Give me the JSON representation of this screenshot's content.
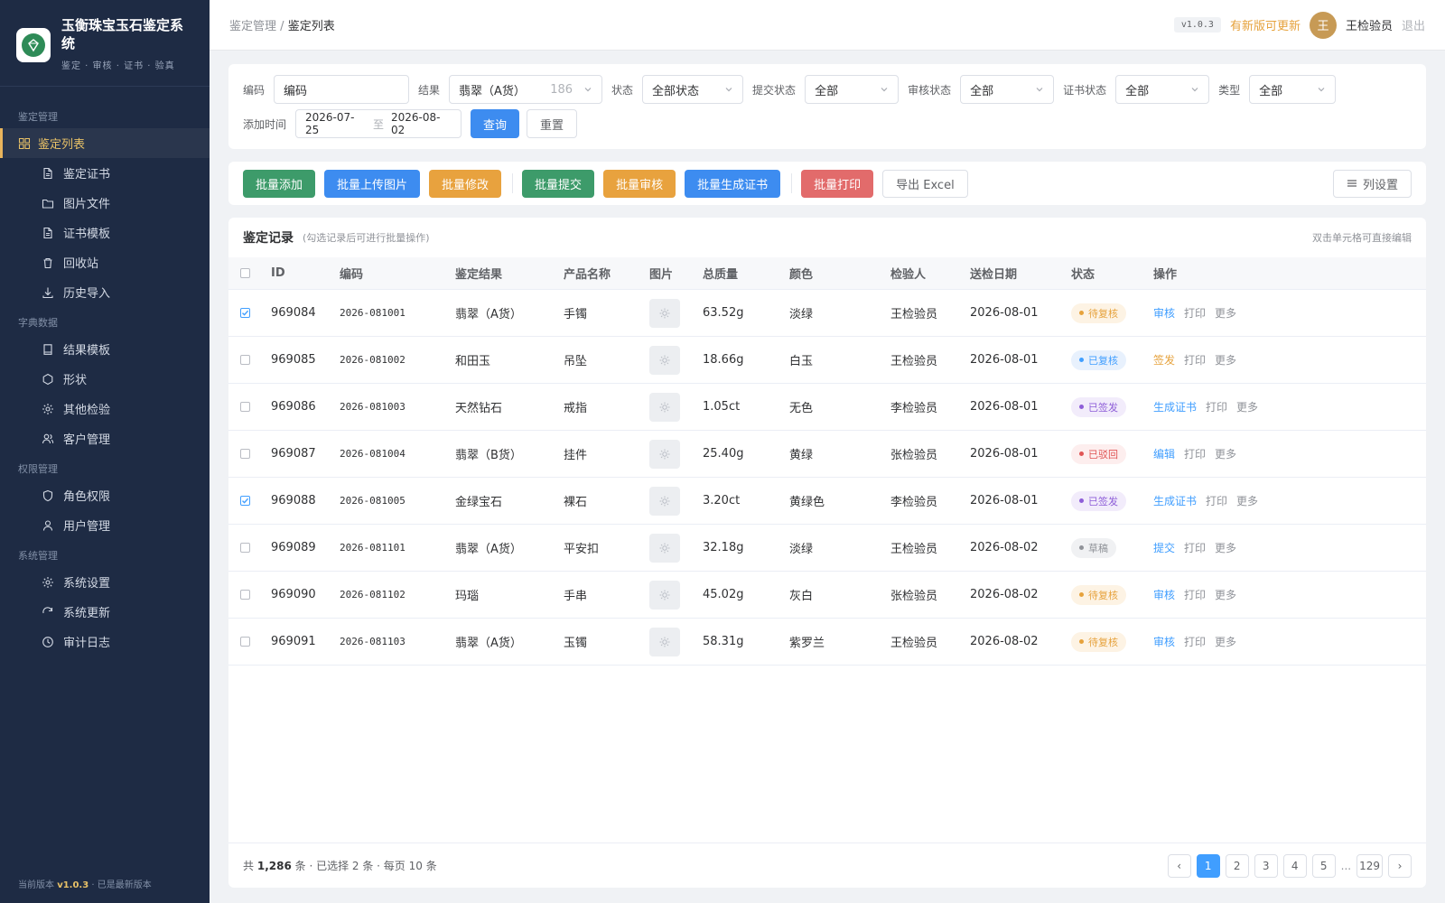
{
  "brand": {
    "title": "玉衡珠宝玉石鉴定系统",
    "subtitle": "鉴定 · 审核 · 证书 · 验真"
  },
  "sidebar": {
    "groups": [
      {
        "label": "鉴定管理",
        "items": [
          {
            "label": "鉴定列表",
            "icon": "grid-icon",
            "active": true
          },
          {
            "label": "鉴定证书",
            "icon": "document-icon"
          },
          {
            "label": "图片文件",
            "icon": "folder-icon"
          },
          {
            "label": "证书模板",
            "icon": "document-icon"
          },
          {
            "label": "回收站",
            "icon": "trash-icon"
          },
          {
            "label": "历史导入",
            "icon": "download-icon"
          }
        ]
      },
      {
        "label": "字典数据",
        "items": [
          {
            "label": "结果模板",
            "icon": "book-icon"
          },
          {
            "label": "形状",
            "icon": "hexagon-icon"
          },
          {
            "label": "其他检验",
            "icon": "gear-icon"
          },
          {
            "label": "客户管理",
            "icon": "users-icon"
          }
        ]
      },
      {
        "label": "权限管理",
        "items": [
          {
            "label": "角色权限",
            "icon": "shield-icon"
          },
          {
            "label": "用户管理",
            "icon": "user-icon"
          }
        ]
      },
      {
        "label": "系统管理",
        "items": [
          {
            "label": "系统设置",
            "icon": "gear-icon"
          },
          {
            "label": "系统更新",
            "icon": "refresh-icon"
          },
          {
            "label": "审计日志",
            "icon": "clock-icon"
          }
        ]
      }
    ],
    "footer_prefix": "当前版本",
    "footer_version": "v1.0.3",
    "footer_suffix": "· 已是最新版本"
  },
  "topbar": {
    "crumb_parent": "鉴定管理",
    "crumb_sep": "/",
    "crumb_current": "鉴定列表",
    "version": "v1.0.3",
    "update_text": "有新版可更新",
    "avatar_char": "王",
    "username": "王检验员",
    "logout": "退出"
  },
  "filters": {
    "code_label": "编码",
    "code_value": "编码",
    "result_label": "结果",
    "result_value": "翡翠（A货）",
    "result_count": "186",
    "status_label": "状态",
    "status_value": "全部状态",
    "submit_label": "提交状态",
    "submit_value": "全部",
    "review_label": "审核状态",
    "review_value": "全部",
    "cert_label": "证书状态",
    "cert_value": "全部",
    "type_label": "类型",
    "type_value": "全部",
    "date_label": "添加时间",
    "date_from": "2026-07-25",
    "date_sep": "至",
    "date_to": "2026-08-02",
    "query": "查询",
    "reset": "重置"
  },
  "actions": {
    "batch_add": "批量添加",
    "batch_upload": "批量上传图片",
    "batch_edit": "批量修改",
    "batch_submit": "批量提交",
    "batch_review": "批量审核",
    "batch_cert": "批量生成证书",
    "batch_print": "批量打印",
    "export": "导出 Excel",
    "columns": "列设置"
  },
  "table": {
    "title": "鉴定记录",
    "hint": "(勾选记录后可进行批量操作)",
    "tip": "双击单元格可直接编辑",
    "headers": {
      "id": "ID",
      "code": "编码",
      "result": "鉴定结果",
      "product": "产品名称",
      "image": "图片",
      "weight": "总质量",
      "color": "颜色",
      "inspector": "检验人",
      "date": "送检日期",
      "status": "状态",
      "ops": "操作"
    },
    "rows": [
      {
        "checked": true,
        "id": "969084",
        "code": "2026-081001",
        "result": "翡翠（A货）",
        "product": "手镯",
        "weight": "63.52g",
        "color": "淡绿",
        "inspector": "王检验员",
        "date": "2026-08-01",
        "status": "待复核",
        "status_type": "pending",
        "op1": "审核",
        "op1_color": "#409eff"
      },
      {
        "checked": false,
        "id": "969085",
        "code": "2026-081002",
        "result": "和田玉",
        "product": "吊坠",
        "weight": "18.66g",
        "color": "白玉",
        "inspector": "王检验员",
        "date": "2026-08-01",
        "status": "已复核",
        "status_type": "reviewed",
        "op1": "签发",
        "op1_color": "#e6a23c"
      },
      {
        "checked": false,
        "id": "969086",
        "code": "2026-081003",
        "result": "天然钻石",
        "product": "戒指",
        "weight": "1.05ct",
        "color": "无色",
        "inspector": "李检验员",
        "date": "2026-08-01",
        "status": "已签发",
        "status_type": "issued",
        "op1": "生成证书",
        "op1_color": "#409eff"
      },
      {
        "checked": false,
        "id": "969087",
        "code": "2026-081004",
        "result": "翡翠（B货）",
        "product": "挂件",
        "weight": "25.40g",
        "color": "黄绿",
        "inspector": "张检验员",
        "date": "2026-08-01",
        "status": "已驳回",
        "status_type": "rejected",
        "op1": "编辑",
        "op1_color": "#409eff"
      },
      {
        "checked": true,
        "id": "969088",
        "code": "2026-081005",
        "result": "金绿宝石",
        "product": "裸石",
        "weight": "3.20ct",
        "color": "黄绿色",
        "inspector": "李检验员",
        "date": "2026-08-01",
        "status": "已签发",
        "status_type": "issued",
        "op1": "生成证书",
        "op1_color": "#409eff"
      },
      {
        "checked": false,
        "id": "969089",
        "code": "2026-081101",
        "result": "翡翠（A货）",
        "product": "平安扣",
        "weight": "32.18g",
        "color": "淡绿",
        "inspector": "王检验员",
        "date": "2026-08-02",
        "status": "草稿",
        "status_type": "draft",
        "op1": "提交",
        "op1_color": "#409eff"
      },
      {
        "checked": false,
        "id": "969090",
        "code": "2026-081102",
        "result": "玛瑙",
        "product": "手串",
        "weight": "45.02g",
        "color": "灰白",
        "inspector": "张检验员",
        "date": "2026-08-02",
        "status": "待复核",
        "status_type": "pending",
        "op1": "审核",
        "op1_color": "#409eff"
      },
      {
        "checked": false,
        "id": "969091",
        "code": "2026-081103",
        "result": "翡翠（A货）",
        "product": "玉镯",
        "weight": "58.31g",
        "color": "紫罗兰",
        "inspector": "王检验员",
        "date": "2026-08-02",
        "status": "待复核",
        "status_type": "pending",
        "op1": "审核",
        "op1_color": "#409eff"
      }
    ],
    "op_print": "打印",
    "op_more": "更多"
  },
  "status_styles": {
    "pending": {
      "bg": "#fdf3e4",
      "fg": "#e6a23c"
    },
    "reviewed": {
      "bg": "#e8f1fd",
      "fg": "#409eff"
    },
    "issued": {
      "bg": "#f2ecfb",
      "fg": "#8e5ed8"
    },
    "rejected": {
      "bg": "#fdeeee",
      "fg": "#e05555"
    },
    "draft": {
      "bg": "#f0f1f3",
      "fg": "#909399"
    }
  },
  "footer": {
    "total_prefix": "共",
    "total": "1,286",
    "total_suffix": "条 · 已选择 2 条 · 每页 10 条",
    "pages": [
      "1",
      "2",
      "3",
      "4",
      "5"
    ],
    "ellipsis": "...",
    "last_page": "129",
    "prev": "‹",
    "next": "›"
  },
  "colors": {
    "green": "#3d9b6a",
    "blue": "#3d8cf0",
    "orange": "#e8a23e",
    "red": "#e26b6b",
    "sidebar": "#1e2b44",
    "accent": "#e8c167"
  }
}
